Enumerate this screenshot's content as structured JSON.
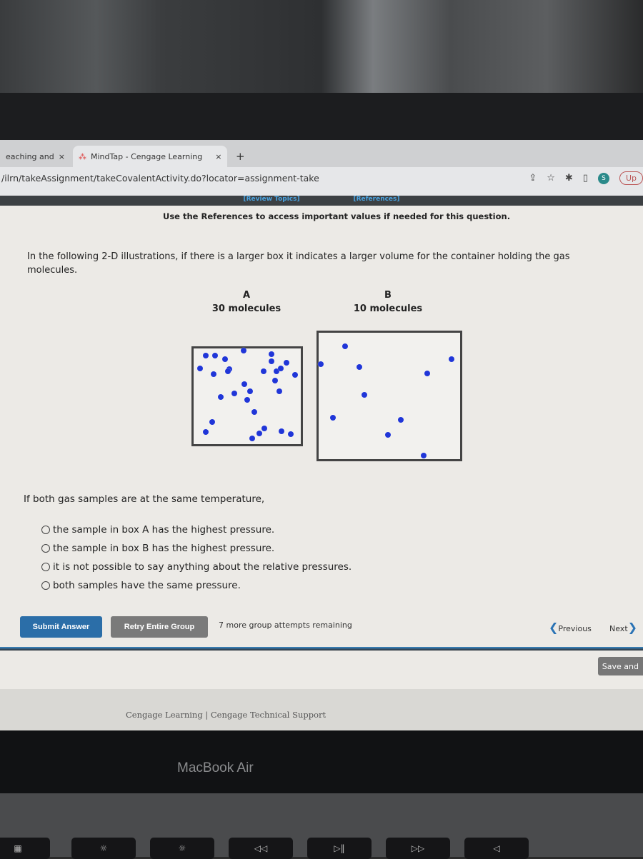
{
  "browser": {
    "tabs": [
      {
        "label": "eaching and",
        "close": "×"
      },
      {
        "label": "MindTap - Cengage Learning",
        "close": "×"
      }
    ],
    "new_tab": "+",
    "url": "/ilrn/takeAssignment/takeCovalentActivity.do?locator=assignment-take",
    "profile_initial": "S",
    "update_label": "Up"
  },
  "nav": {
    "review_topics": "[Review Topics]",
    "references": "[References]"
  },
  "question": {
    "reference_note": "Use the References to access important values if needed for this question.",
    "text": "In the following 2-D illustrations, if there is a larger box it indicates a larger volume for the container holding the gas molecules.",
    "box_a": {
      "label": "A",
      "count": "30 molecules",
      "molecules": 30
    },
    "box_b": {
      "label": "B",
      "count": "10 molecules",
      "molecules": 10
    },
    "molecule_color": "#2036d8",
    "prompt": "If both gas samples are at the same temperature,",
    "options": [
      "the sample in box A has the highest pressure.",
      "the sample in box B has the highest pressure.",
      "it is not possible to say anything about the relative pressures.",
      "both samples have the same pressure."
    ]
  },
  "actions": {
    "submit": "Submit Answer",
    "retry": "Retry Entire Group",
    "attempts": "7 more group attempts remaining",
    "previous": "Previous",
    "next": "Next",
    "save": "Save and"
  },
  "footer": {
    "links": "Cengage Learning  |  Cengage Technical Support"
  },
  "device": {
    "label": "MacBook Air"
  },
  "colors": {
    "submit": "#2b6ea8",
    "retry": "#7a7a7a",
    "link": "#4aa3e0"
  }
}
